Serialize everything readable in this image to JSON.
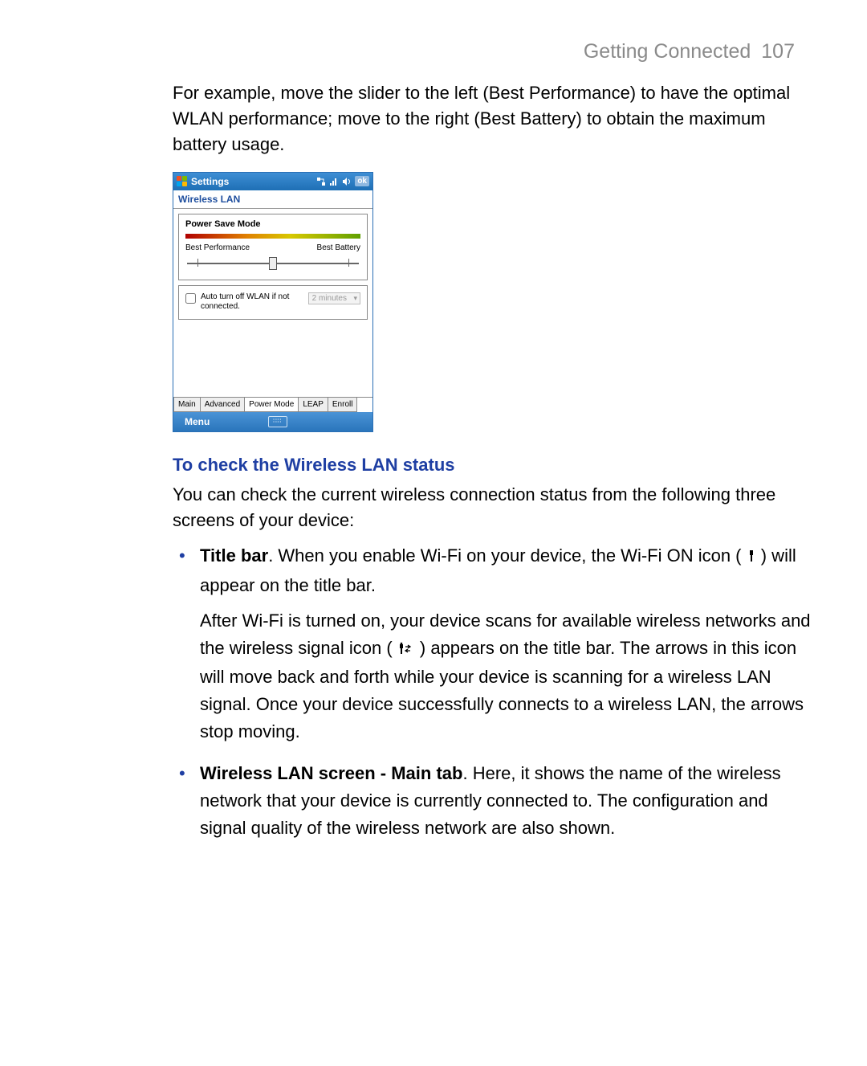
{
  "header": {
    "section": "Getting Connected",
    "page": "107"
  },
  "intro": "For example, move the slider to the left (Best Performance) to have the optimal WLAN performance; move to the right (Best Battery) to obtain the maximum battery usage.",
  "screenshot": {
    "title": "Settings",
    "ok": "ok",
    "breadcrumb": "Wireless LAN",
    "panel_title": "Power Save Mode",
    "left_label": "Best Performance",
    "right_label": "Best Battery",
    "auto_off_label": "Auto turn off WLAN if not connected.",
    "auto_off_value": "2 minutes",
    "tabs": [
      "Main",
      "Advanced",
      "Power Mode",
      "LEAP",
      "Enroll"
    ],
    "active_tab": 2,
    "menu": "Menu"
  },
  "section_heading": "To check the Wireless LAN status",
  "section_intro": "You can check the current wireless connection status from the following three screens of your device:",
  "bullets": [
    {
      "lead": "Title bar",
      "t1": ". When you enable Wi-Fi on your device, the Wi-Fi ON icon ( ",
      "t2": " ) will appear on the title bar.",
      "para2a": "After Wi-Fi is turned on, your device scans for available wireless networks and the wireless signal icon ( ",
      "para2b": " ) appears on the title bar. The arrows in this icon will move back and forth while your device is scanning for a wireless LAN signal. Once your device successfully connects to a wireless LAN, the arrows stop moving."
    },
    {
      "lead": "Wireless LAN screen - Main tab",
      "t1": ". Here, it shows the name of the wireless network that your device is currently connected to. The configuration and signal quality of the wireless network are also shown."
    }
  ]
}
